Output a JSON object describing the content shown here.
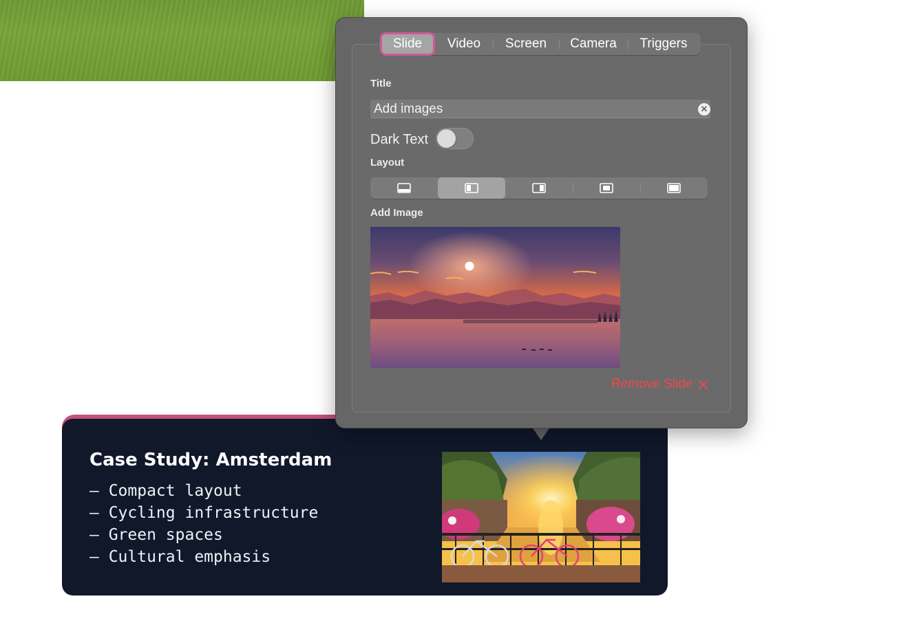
{
  "popover": {
    "tabs": [
      "Slide",
      "Video",
      "Screen",
      "Camera",
      "Triggers"
    ],
    "active_tab": "Slide",
    "title_label": "Title",
    "title_value": "Add images",
    "dark_text_label": "Dark Text",
    "dark_text_on": false,
    "layout_label": "Layout",
    "layout_options": [
      "bottom-banner-icon",
      "left-panel-icon",
      "right-panel-icon",
      "center-box-icon",
      "full-frame-icon"
    ],
    "layout_selected_index": 1,
    "add_image_label": "Add Image",
    "remove_label": "Remove Slide"
  },
  "slide": {
    "title": "Case Study: Amsterdam",
    "bullets": [
      "– Compact layout",
      "– Cycling infrastructure",
      "– Green spaces",
      "– Cultural emphasis"
    ]
  },
  "colors": {
    "accent": "#c44f7c",
    "slide_bg": "#10182a",
    "popover_bg": "#666666",
    "danger": "#f0484d"
  }
}
